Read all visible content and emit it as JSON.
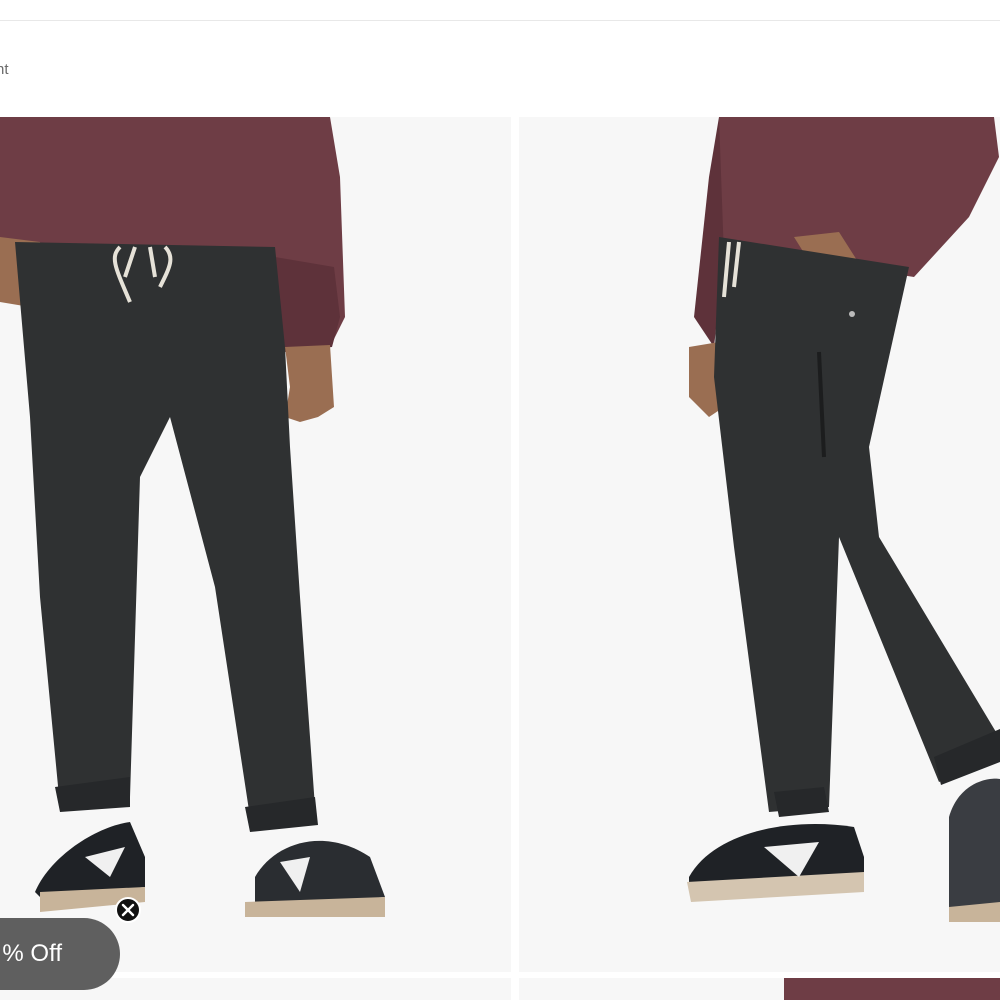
{
  "breadcrumb": {
    "label": "nt"
  },
  "gallery": {
    "images": [
      {
        "name": "front-view",
        "icon": "product-photo-front"
      },
      {
        "name": "side-view",
        "icon": "product-photo-side"
      }
    ]
  },
  "promo": {
    "label": "% Off",
    "close_icon": "close-icon"
  },
  "colors": {
    "photo_bg": "#f7f7f7",
    "sweater": "#6e3d45",
    "pants": "#2f3132",
    "promo_bg": "#5f5f5f"
  }
}
